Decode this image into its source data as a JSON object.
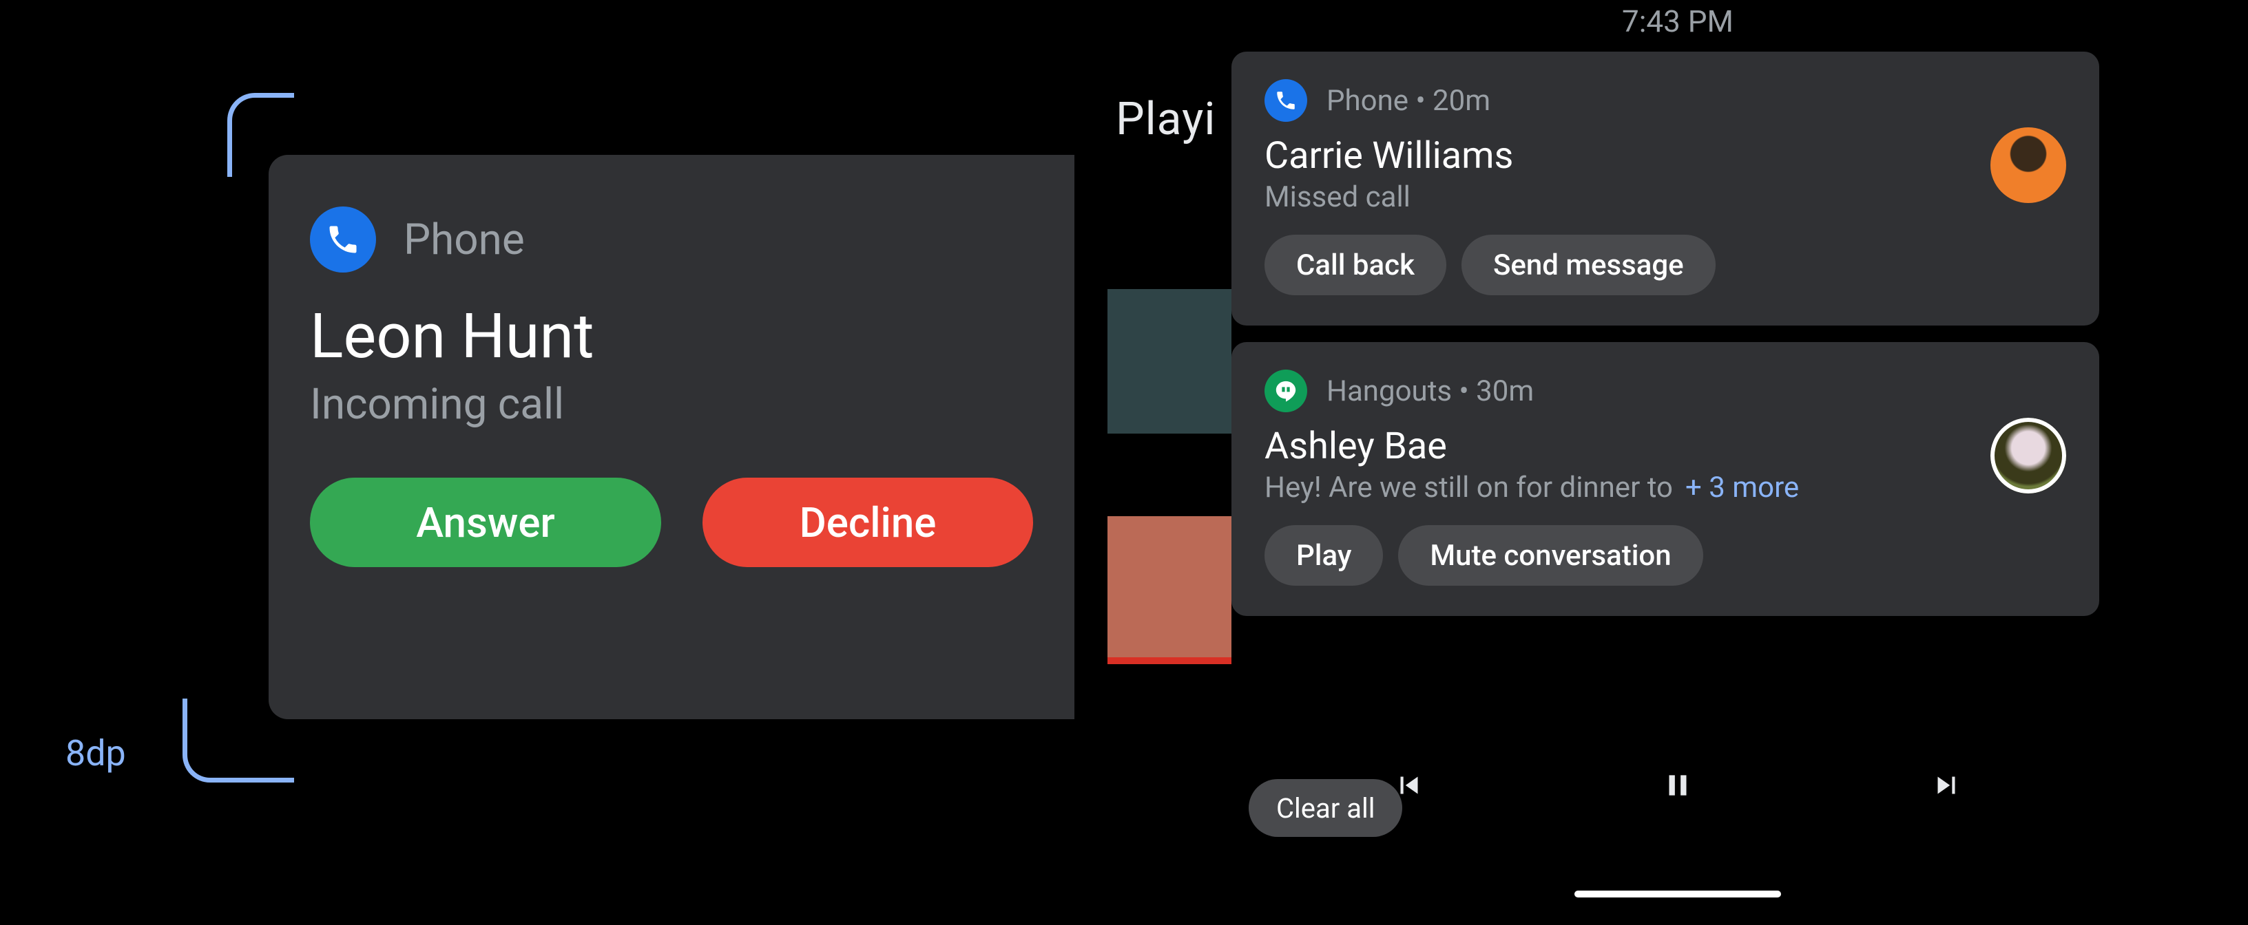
{
  "annotation": {
    "measure_label": "8dp"
  },
  "hun": {
    "app": "Phone",
    "title": "Leon Hunt",
    "subtitle": "Incoming call",
    "actions": {
      "answer": "Answer",
      "decline": "Decline"
    }
  },
  "statusbar": {
    "clock": "7:43 PM"
  },
  "background": {
    "now_playing_fragment": "Playi"
  },
  "notifications": [
    {
      "app": "Phone",
      "icon": "phone-icon",
      "meta": "Phone • 20m",
      "title": "Carrie Williams",
      "body": "Missed call",
      "more": "",
      "actions": [
        "Call back",
        "Send message"
      ]
    },
    {
      "app": "Hangouts",
      "icon": "hangouts-icon",
      "meta": "Hangouts • 30m",
      "title": "Ashley Bae",
      "body": "Hey! Are we still on for dinner to",
      "more": "+ 3 more",
      "actions": [
        "Play",
        "Mute conversation"
      ]
    }
  ],
  "clear_all": "Clear all"
}
